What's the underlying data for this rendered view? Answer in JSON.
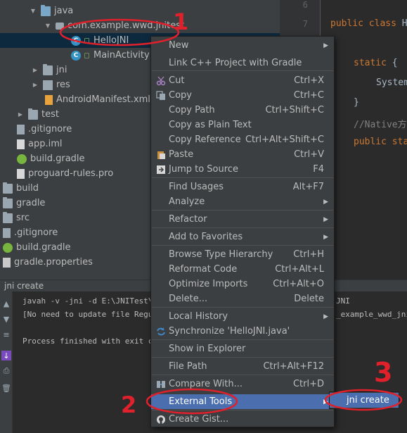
{
  "project_tree": {
    "items": [
      {
        "label": "java",
        "icon": "folder-icon"
      },
      {
        "label": "com.example.wwd.jnitest",
        "icon": "package-icon"
      },
      {
        "label": "HelloJNI",
        "icon": "class-icon"
      },
      {
        "label": "MainActivity",
        "icon": "class-icon"
      },
      {
        "label": "jni",
        "icon": "folder-icon"
      },
      {
        "label": "res",
        "icon": "folder-icon"
      },
      {
        "label": "AndroidManifest.xml",
        "icon": "xml-file-icon"
      },
      {
        "label": "test",
        "icon": "folder-icon"
      },
      {
        "label": ".gitignore",
        "icon": "file-icon"
      },
      {
        "label": "app.iml",
        "icon": "file-icon"
      },
      {
        "label": "build.gradle",
        "icon": "gradle-icon"
      },
      {
        "label": "proguard-rules.pro",
        "icon": "file-icon"
      },
      {
        "label": "build",
        "icon": "folder-icon"
      },
      {
        "label": "gradle",
        "icon": "folder-icon"
      },
      {
        "label": "src",
        "icon": "folder-icon"
      },
      {
        "label": ".gitignore",
        "icon": "file-icon"
      },
      {
        "label": "build.gradle",
        "icon": "gradle-icon"
      },
      {
        "label": "gradle.properties",
        "icon": "file-icon"
      }
    ]
  },
  "editor": {
    "line_numbers": [
      "6",
      "7"
    ],
    "lines": [
      {
        "kw": "public class ",
        "rest": "H"
      },
      {
        "kw": "static ",
        "rest": "{"
      },
      {
        "kw": "",
        "rest": "System"
      },
      {
        "kw": "",
        "rest": "}"
      },
      {
        "kw": "",
        "rest": "//Native方"
      },
      {
        "kw": "public sta",
        "rest": ""
      }
    ]
  },
  "run_panel": {
    "title": "jni create",
    "console": [
      "javah -v -jni -d E:\\JNITest\\app",
      "[No need to update file Regular",
      "Process finished with exit code"
    ],
    "console_right": [
      "JNI",
      "_example_wwd_jnite"
    ]
  },
  "context_menu": {
    "items": [
      {
        "label": "New",
        "shortcut": "",
        "submenu": true,
        "icon": ""
      },
      {
        "label": "Link C++ Project with Gradle",
        "shortcut": "",
        "submenu": false,
        "icon": ""
      },
      {
        "label": "Cut",
        "shortcut": "Ctrl+X",
        "submenu": false,
        "icon": "cut-icon"
      },
      {
        "label": "Copy",
        "shortcut": "Ctrl+C",
        "submenu": false,
        "icon": "copy-icon"
      },
      {
        "label": "Copy Path",
        "shortcut": "Ctrl+Shift+C",
        "submenu": false,
        "icon": ""
      },
      {
        "label": "Copy as Plain Text",
        "shortcut": "",
        "submenu": false,
        "icon": ""
      },
      {
        "label": "Copy Reference",
        "shortcut": "Ctrl+Alt+Shift+C",
        "submenu": false,
        "icon": ""
      },
      {
        "label": "Paste",
        "shortcut": "Ctrl+V",
        "submenu": false,
        "icon": "paste-icon"
      },
      {
        "label": "Jump to Source",
        "shortcut": "F4",
        "submenu": false,
        "icon": "jump-icon"
      },
      {
        "label": "Find Usages",
        "shortcut": "Alt+F7",
        "submenu": false,
        "icon": ""
      },
      {
        "label": "Analyze",
        "shortcut": "",
        "submenu": true,
        "icon": ""
      },
      {
        "label": "Refactor",
        "shortcut": "",
        "submenu": true,
        "icon": ""
      },
      {
        "label": "Add to Favorites",
        "shortcut": "",
        "submenu": true,
        "icon": ""
      },
      {
        "label": "Browse Type Hierarchy",
        "shortcut": "Ctrl+H",
        "submenu": false,
        "icon": ""
      },
      {
        "label": "Reformat Code",
        "shortcut": "Ctrl+Alt+L",
        "submenu": false,
        "icon": ""
      },
      {
        "label": "Optimize Imports",
        "shortcut": "Ctrl+Alt+O",
        "submenu": false,
        "icon": ""
      },
      {
        "label": "Delete...",
        "shortcut": "Delete",
        "submenu": false,
        "icon": ""
      },
      {
        "label": "Local History",
        "shortcut": "",
        "submenu": true,
        "icon": ""
      },
      {
        "label": "Synchronize 'HelloJNI.java'",
        "shortcut": "",
        "submenu": false,
        "icon": "sync-icon"
      },
      {
        "label": "Show in Explorer",
        "shortcut": "",
        "submenu": false,
        "icon": ""
      },
      {
        "label": "File Path",
        "shortcut": "Ctrl+Alt+F12",
        "submenu": false,
        "icon": ""
      },
      {
        "label": "Compare With...",
        "shortcut": "Ctrl+D",
        "submenu": false,
        "icon": "compare-icon"
      },
      {
        "label": "External Tools",
        "shortcut": "",
        "submenu": true,
        "icon": ""
      },
      {
        "label": "Create Gist...",
        "shortcut": "",
        "submenu": false,
        "icon": "github-icon"
      }
    ]
  },
  "submenu": {
    "items": [
      {
        "label": "jni create"
      }
    ]
  },
  "annotations": {
    "marks": [
      "1",
      "2",
      "3"
    ],
    "color": "#e0202a"
  },
  "colors": {
    "menu_highlight": "#4b6eaf",
    "tree_bg": "#3c3f41",
    "editor_bg": "#2b2b2b",
    "keyword": "#cc7832"
  }
}
